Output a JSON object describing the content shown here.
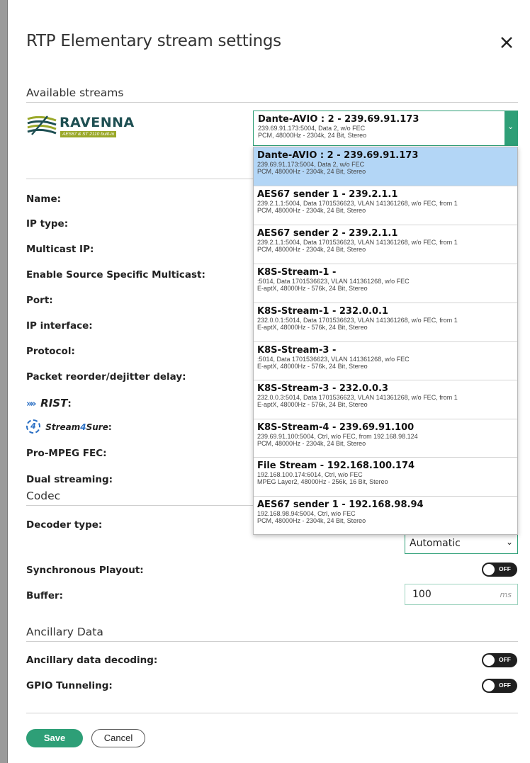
{
  "dialog": {
    "title": "RTP Elementary stream settings"
  },
  "available": {
    "heading": "Available streams",
    "logo_text": "RAVENNA",
    "logo_badge": "AES67 & ST 2110 built-in",
    "selected": {
      "title": "Dante-AVIO : 2 - 239.69.91.173",
      "line1": "239.69.91.173:5004, Data 2, w/o FEC",
      "line2": "PCM, 48000Hz - 2304k, 24 Bit, Stereo"
    },
    "options": [
      {
        "title": "Dante-AVIO : 2 - 239.69.91.173",
        "line1": "239.69.91.173:5004, Data 2, w/o FEC",
        "line2": "PCM, 48000Hz - 2304k, 24 Bit, Stereo"
      },
      {
        "title": "AES67 sender 1 - 239.2.1.1",
        "line1": "239.2.1.1:5004, Data 1701536623, VLAN 141361268, w/o FEC, from 1",
        "line2": "PCM, 48000Hz - 2304k, 24 Bit, Stereo"
      },
      {
        "title": "AES67 sender 2 - 239.2.1.1",
        "line1": "239.2.1.1:5004, Data 1701536623, VLAN 141361268, w/o FEC, from 1",
        "line2": "PCM, 48000Hz - 2304k, 24 Bit, Stereo"
      },
      {
        "title": "K8S-Stream-1 -",
        "line1": ":5014, Data 1701536623, VLAN 141361268, w/o FEC",
        "line2": "E-aptX, 48000Hz - 576k, 24 Bit, Stereo"
      },
      {
        "title": "K8S-Stream-1 - 232.0.0.1",
        "line1": "232.0.0.1:5014, Data 1701536623, VLAN 141361268, w/o FEC, from 1",
        "line2": "E-aptX, 48000Hz - 576k, 24 Bit, Stereo"
      },
      {
        "title": "K8S-Stream-3 -",
        "line1": ":5014, Data 1701536623, VLAN 141361268, w/o FEC",
        "line2": "E-aptX, 48000Hz - 576k, 24 Bit, Stereo"
      },
      {
        "title": "K8S-Stream-3 - 232.0.0.3",
        "line1": "232.0.0.3:5014, Data 1701536623, VLAN 141361268, w/o FEC, from 1",
        "line2": "E-aptX, 48000Hz - 576k, 24 Bit, Stereo"
      },
      {
        "title": "K8S-Stream-4 - 239.69.91.100",
        "line1": "239.69.91.100:5004, Ctrl, w/o FEC, from 192.168.98.124",
        "line2": "PCM, 48000Hz - 2304k, 24 Bit, Stereo"
      },
      {
        "title": "File Stream - 192.168.100.174",
        "line1": "192.168.100.174:6014, Ctrl, w/o FEC",
        "line2": "MPEG Layer2, 48000Hz - 256k, 16 Bit, Stereo"
      },
      {
        "title": "AES67 sender 1 - 192.168.98.94",
        "line1": "192.168.98.94:5004, Ctrl, w/o FEC",
        "line2": "PCM, 48000Hz - 2304k, 24 Bit, Stereo"
      }
    ]
  },
  "labels": {
    "name": "Name:",
    "ip_type": "IP type:",
    "multicast_ip": "Multicast IP:",
    "ssm": "Enable Source Specific Multicast:",
    "port": "Port:",
    "ip_interface": "IP interface:",
    "protocol": "Protocol:",
    "dejitter": "Packet reorder/dejitter delay:",
    "rist_logo": "RIST",
    "rist_suffix": ":",
    "s4s_logo_a": "Stream",
    "s4s_logo_b": "4",
    "s4s_logo_c": "Sure",
    "s4s_suffix": ":",
    "s4s_badge": "4",
    "pro_mpeg": "Pro-MPEG FEC:",
    "dual": "Dual streaming:"
  },
  "codec": {
    "heading": "Codec",
    "decoder_label": "Decoder type:",
    "decoder_value": "Automatic",
    "sync_label": "Synchronous Playout:",
    "sync_state": "OFF",
    "buffer_label": "Buffer:",
    "buffer_value": "100",
    "buffer_unit": "ms"
  },
  "ancillary": {
    "heading": "Ancillary Data",
    "decoding_label": "Ancillary data decoding:",
    "decoding_state": "OFF",
    "gpio_label": "GPIO Tunneling:",
    "gpio_state": "OFF"
  },
  "footer": {
    "save": "Save",
    "cancel": "Cancel"
  },
  "colors": {
    "accent": "#2e9f77",
    "selected_row": "#b3d6f6",
    "toggle_off": "#1f1f1f"
  }
}
